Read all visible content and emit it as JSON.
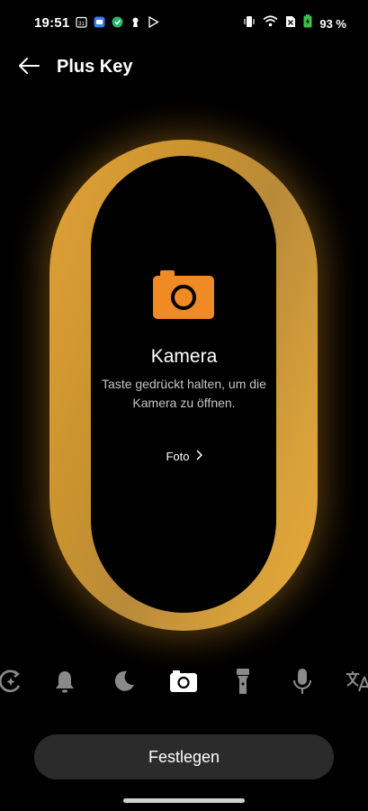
{
  "status_bar": {
    "time": "19:51",
    "left_icons": [
      "calendar-icon",
      "messages-icon",
      "vpn-icon",
      "keyhole-icon",
      "play-store-icon"
    ],
    "right_icons": [
      "vibrate-icon",
      "wifi-icon",
      "no-sim-icon",
      "battery-charging-icon"
    ],
    "battery": "93 %"
  },
  "app_bar": {
    "back_icon": "arrow-left-icon",
    "title": "Plus Key"
  },
  "key_panel": {
    "accent_color": "#E8A33A",
    "icon": "camera-icon",
    "title": "Kamera",
    "description": "Taste gedrückt halten, um die Kamera zu öffnen.",
    "option_label": "Foto",
    "option_icon": "chevron-right-icon"
  },
  "mode_icons": [
    {
      "name": "ai-refresh-icon",
      "selected": false
    },
    {
      "name": "bell-icon",
      "selected": false
    },
    {
      "name": "moon-icon",
      "selected": false
    },
    {
      "name": "camera-icon",
      "selected": true
    },
    {
      "name": "flashlight-icon",
      "selected": false
    },
    {
      "name": "microphone-icon",
      "selected": false
    },
    {
      "name": "translate-icon",
      "selected": false
    }
  ],
  "primary_button": {
    "label": "Festlegen"
  }
}
